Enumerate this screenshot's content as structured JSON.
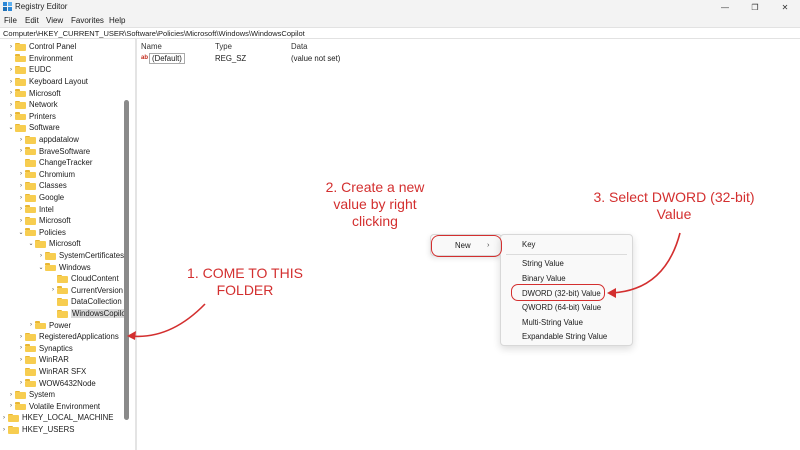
{
  "window": {
    "title": "Registry Editor",
    "minimize_glyph": "—",
    "maximize_glyph": "❐",
    "close_glyph": "✕"
  },
  "menu": [
    "File",
    "Edit",
    "View",
    "Favorites",
    "Help"
  ],
  "address": "Computer\\HKEY_CURRENT_USER\\Software\\Policies\\Microsoft\\Windows\\WindowsCopilot",
  "tree": [
    {
      "label": "Control Panel",
      "chevron": "›"
    },
    {
      "label": "Environment",
      "chevron": ""
    },
    {
      "label": "EUDC",
      "chevron": "›"
    },
    {
      "label": "Keyboard Layout",
      "chevron": "›"
    },
    {
      "label": "Microsoft",
      "chevron": "›"
    },
    {
      "label": "Network",
      "chevron": "›"
    },
    {
      "label": "Printers",
      "chevron": "›"
    },
    {
      "label": "Software",
      "chevron": "⌄"
    },
    {
      "label": "appdatalow",
      "chevron": "›"
    },
    {
      "label": "BraveSoftware",
      "chevron": "›"
    },
    {
      "label": "ChangeTracker",
      "chevron": ""
    },
    {
      "label": "Chromium",
      "chevron": "›"
    },
    {
      "label": "Classes",
      "chevron": "›"
    },
    {
      "label": "Google",
      "chevron": "›"
    },
    {
      "label": "Intel",
      "chevron": "›"
    },
    {
      "label": "Microsoft",
      "chevron": "›"
    },
    {
      "label": "Policies",
      "chevron": "⌄"
    },
    {
      "label": "Microsoft",
      "chevron": "⌄"
    },
    {
      "label": "SystemCertificates",
      "chevron": "›"
    },
    {
      "label": "Windows",
      "chevron": "⌄"
    },
    {
      "label": "CloudContent",
      "chevron": ""
    },
    {
      "label": "CurrentVersion",
      "chevron": "›"
    },
    {
      "label": "DataCollection",
      "chevron": ""
    },
    {
      "label": "WindowsCopilot",
      "chevron": ""
    },
    {
      "label": "Power",
      "chevron": "›"
    },
    {
      "label": "RegisteredApplications",
      "chevron": "›"
    },
    {
      "label": "Synaptics",
      "chevron": "›"
    },
    {
      "label": "WinRAR",
      "chevron": "›"
    },
    {
      "label": "WinRAR SFX",
      "chevron": ""
    },
    {
      "label": "WOW6432Node",
      "chevron": "›"
    },
    {
      "label": "System",
      "chevron": "›"
    },
    {
      "label": "Volatile Environment",
      "chevron": "›"
    },
    {
      "label": "HKEY_LOCAL_MACHINE",
      "chevron": "›"
    },
    {
      "label": "HKEY_USERS",
      "chevron": "›"
    }
  ],
  "values_pane": {
    "headers": {
      "name": "Name",
      "type": "Type",
      "data": "Data"
    },
    "rows": [
      {
        "icon": "ab",
        "name": "(Default)",
        "type": "REG_SZ",
        "data": "(value not set)"
      }
    ]
  },
  "context_menu": {
    "new_label": "New",
    "new_arrow": "›",
    "submenu": [
      "Key",
      "String Value",
      "Binary Value",
      "DWORD (32-bit) Value",
      "QWORD (64-bit) Value",
      "Multi-String Value",
      "Expandable String Value"
    ]
  },
  "annotations": {
    "step1": [
      "1. COME TO THIS",
      "FOLDER"
    ],
    "step2": [
      "2. Create a new",
      "value by right",
      "clicking"
    ],
    "step3": [
      "3. Select DWORD (32-bit)",
      "Value"
    ]
  },
  "colors": {
    "annotation": "#d32f2f",
    "folder": "#f7cd50",
    "chrome": "#f3f3f3"
  }
}
